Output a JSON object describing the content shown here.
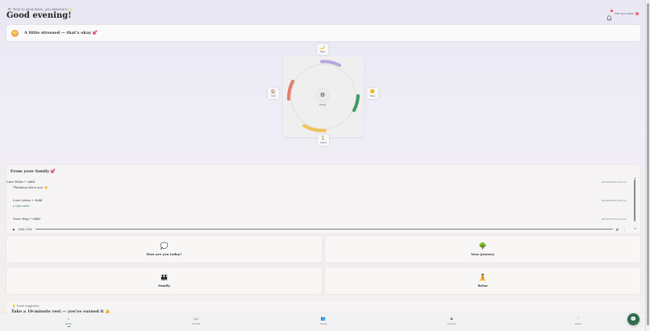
{
  "header": {
    "kicker": "☕ Time to wind down, you deserve it ✨",
    "title": "Good evening!",
    "see_you_label": "See you soon"
  },
  "mood": {
    "emoji": "😳",
    "text": "A little stressed — that's okay 💕"
  },
  "wheel": {
    "center_icon": "⚙",
    "center_label": "Today",
    "satellites": [
      {
        "key": "top",
        "icon": "🌙",
        "label": "Sleep"
      },
      {
        "key": "left",
        "icon": "🏠",
        "label": "Rest"
      },
      {
        "key": "right",
        "icon": "😊",
        "label": "Mood"
      },
      {
        "key": "bottom",
        "icon": "🚶",
        "label": "Activity"
      }
    ],
    "arc_colors": {
      "top": "#b5a6dc",
      "left": "#e57b6a",
      "right": "#3f9a66",
      "bottom": "#f0c25a"
    }
  },
  "family": {
    "title": "From your family 💕",
    "messages": [
      {
        "title": "Care Pulse • child",
        "body": "Thinking about you 👋",
        "time": "09/20/2025 8:40:29 pm"
      },
      {
        "title": "Love Letter • child",
        "body": "",
        "time": "09/20/2025 8:40:55 pm",
        "action": "▸ Open letter"
      },
      {
        "title": "Voice Hug • child",
        "body": "",
        "time": "09/20/2025 8:40:44 pm"
      }
    ],
    "audio": {
      "time": "0:00 / 0:01",
      "play_icon": "▶",
      "volume_icon": "🔊",
      "more_icon": "⋮"
    }
  },
  "tiles": [
    {
      "icon": "💭",
      "label": "How are you today?"
    },
    {
      "icon": "🌳",
      "label": "Your Journey"
    },
    {
      "icon": "👪",
      "label": "Family"
    },
    {
      "icon": "🧘",
      "label": "Relax"
    }
  ],
  "suggestion": {
    "kicker": "💡 Smart suggestion",
    "text": "Take a 10-minute rest — you've earned it 👍"
  },
  "nav": [
    {
      "icon": "⌂",
      "label": "Home",
      "active": true
    },
    {
      "icon": "📖",
      "label": "Journal",
      "active": false
    },
    {
      "icon": "👥",
      "label": "Family",
      "active": false
    },
    {
      "icon": "⛰",
      "label": "Journey",
      "active": false
    },
    {
      "icon": "♡",
      "label": "Relax",
      "active": false
    }
  ],
  "fab_icon": "💬",
  "colors": {
    "accent": "#2f7a52",
    "fab": "#2e6e4b"
  }
}
